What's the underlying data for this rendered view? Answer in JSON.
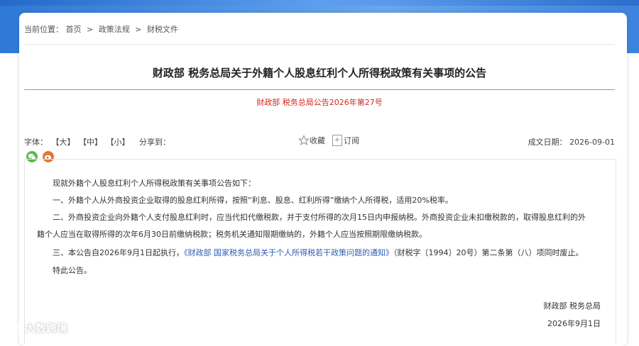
{
  "breadcrumb": {
    "prefix": "当前位置：",
    "items": [
      "首页",
      "政策法规",
      "财税文件"
    ],
    "separator": ">"
  },
  "article": {
    "title": "财政部 税务总局关于外籍个人股息红利个人所得税政策有关事项的公告",
    "doc_number": "财政部 税务总局公告2026年第27号"
  },
  "toolbar": {
    "font_label": "字体：",
    "font_large": "【大】",
    "font_medium": "【中】",
    "font_small": "【小】",
    "share_label": "分享到：",
    "favorite": "收藏",
    "subscribe": "订阅",
    "date_label": "成文日期：",
    "date_value": "2026-09-01"
  },
  "body": {
    "p0": "现就外籍个人股息红利个人所得税政策有关事项公告如下：",
    "p1": "一、外籍个人从外商投资企业取得的股息红利所得，按照“利息、股息、红利所得”缴纳个人所得税，适用20%税率。",
    "p2a": "二、外商投资企业向外籍个人支付股息红利时，应当代扣代缴税款，并于支付所得的次月15日内申报纳税。外商投资企业未扣缴税款的，取得股息红利的外",
    "p2b": "籍个人应当在取得所得的次年6月30日前缴纳税款；税务机关通知限期缴纳的，外籍个人应当按照期限缴纳税款。",
    "p3_pre": "三、本公告自2026年9月1日起执行，",
    "p3_link": "《财政部 国家税务总局关于个人所得税若干政策问题的通知》",
    "p3_post": "（财税字〔1994〕20号）第二条第（八）项同时废止。",
    "p4": "特此公告。"
  },
  "signature": {
    "org": "财政部 税务总局",
    "date": "2026年9月1日"
  },
  "watermark": {
    "text": "大数跨境"
  },
  "icons": {
    "favorite": "star-icon",
    "subscribe": "subscribe-icon",
    "share_wechat": "wechat-icon",
    "share_weibo": "weibo-icon"
  },
  "colors": {
    "doc_number": "#d4261c",
    "link": "#2b5fb0",
    "header_blue": "#3c83de"
  }
}
